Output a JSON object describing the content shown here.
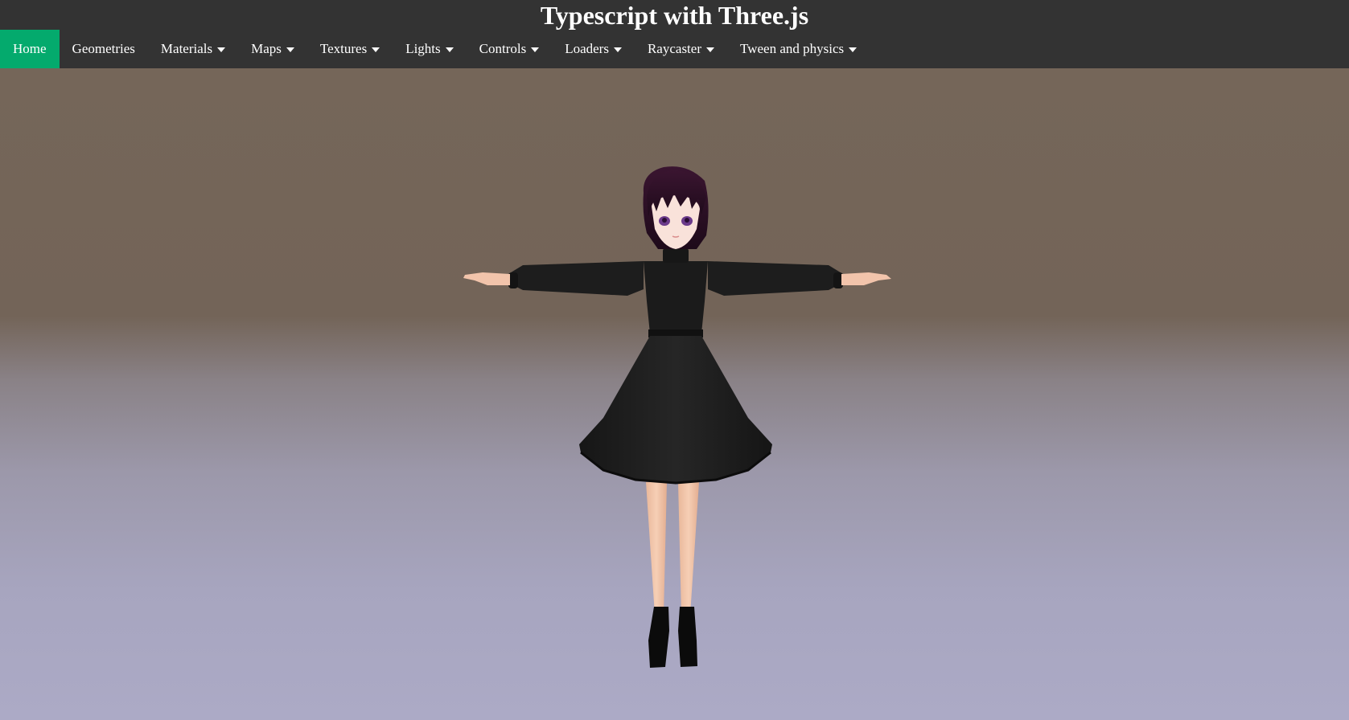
{
  "header": {
    "title": "Typescript with Three.js"
  },
  "nav": {
    "items": [
      {
        "label": "Home",
        "active": true,
        "dropdown": false
      },
      {
        "label": "Geometries",
        "active": false,
        "dropdown": false
      },
      {
        "label": "Materials",
        "active": false,
        "dropdown": true
      },
      {
        "label": "Maps",
        "active": false,
        "dropdown": true
      },
      {
        "label": "Textures",
        "active": false,
        "dropdown": true
      },
      {
        "label": "Lights",
        "active": false,
        "dropdown": true
      },
      {
        "label": "Controls",
        "active": false,
        "dropdown": true
      },
      {
        "label": "Loaders",
        "active": false,
        "dropdown": true
      },
      {
        "label": "Raycaster",
        "active": false,
        "dropdown": true
      },
      {
        "label": "Tween and physics",
        "active": false,
        "dropdown": true
      }
    ]
  },
  "colors": {
    "header_bg": "#333333",
    "active_nav": "#04AA6D",
    "nav_text": "#ffffff"
  },
  "icons": {
    "dropdown": "caret-down-icon"
  }
}
